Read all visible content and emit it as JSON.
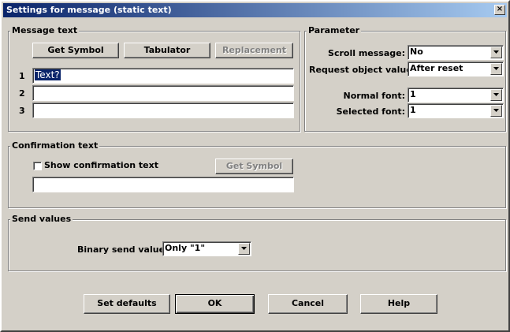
{
  "window": {
    "title": "Settings for message (static text)",
    "close_glyph": "×"
  },
  "message_text": {
    "label": "Message text",
    "buttons": {
      "get_symbol": "Get Symbol",
      "tabulator": "Tabulator",
      "replacement": "Replacement"
    },
    "lines": [
      {
        "number": "1",
        "value": "Text?"
      },
      {
        "number": "2",
        "value": ""
      },
      {
        "number": "3",
        "value": ""
      }
    ]
  },
  "parameter": {
    "label": "Parameter",
    "scroll_message": {
      "label": "Scroll message:",
      "value": "No"
    },
    "request_object_value": {
      "label": "Request object value:",
      "value": "After reset"
    },
    "normal_font": {
      "label": "Normal font:",
      "value": "1"
    },
    "selected_font": {
      "label": "Selected font:",
      "value": "1"
    }
  },
  "confirmation_text": {
    "label": "Confirmation text",
    "show_checkbox": {
      "label": "Show confirmation text",
      "checked": false
    },
    "get_symbol": "Get Symbol",
    "value": ""
  },
  "send_values": {
    "label": "Send values",
    "binary_send_value": {
      "label": "Binary send value:",
      "value": "Only \"1\""
    }
  },
  "footer": {
    "set_defaults": "Set defaults",
    "ok": "OK",
    "cancel": "Cancel",
    "help": "Help"
  },
  "icons": {
    "close": "close-icon",
    "dropdown": "chevron-down-icon"
  }
}
